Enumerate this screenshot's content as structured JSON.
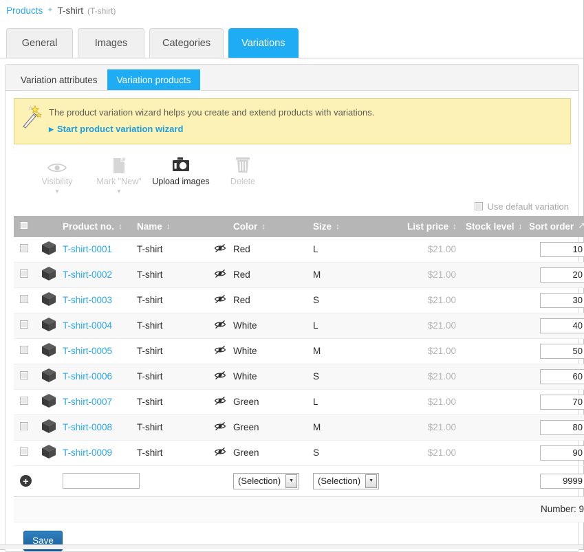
{
  "breadcrumb": {
    "root": "Products",
    "separator": "✦",
    "current": "T-shirt",
    "current_sub": "(T-shirt)"
  },
  "tabs": [
    {
      "label": "General",
      "active": false
    },
    {
      "label": "Images",
      "active": false
    },
    {
      "label": "Categories",
      "active": false
    },
    {
      "label": "Variations",
      "active": true
    }
  ],
  "subtabs": [
    {
      "label": "Variation attributes",
      "active": false
    },
    {
      "label": "Variation products",
      "active": true
    }
  ],
  "wizard": {
    "icon": "magic-wand-icon",
    "text": "The product variation wizard helps you create and extend products with variations.",
    "link": "Start product variation wizard"
  },
  "toolbar": [
    {
      "label": "Visibility",
      "icon": "eye-icon",
      "enabled": false,
      "caret": true
    },
    {
      "label": "Mark \"New\"",
      "icon": "page-star-icon",
      "enabled": false,
      "caret": true
    },
    {
      "label": "Upload images",
      "icon": "camera-icon",
      "enabled": true,
      "caret": false
    },
    {
      "label": "Delete",
      "icon": "trash-icon",
      "enabled": false,
      "caret": false
    }
  ],
  "default_variation": {
    "label": "Use default variation",
    "checked": false
  },
  "table": {
    "columns": [
      {
        "label": "Product no.",
        "sort": "updown"
      },
      {
        "label": "Name",
        "sort": "updown"
      },
      {
        "label": "Color",
        "sort": "updown"
      },
      {
        "label": "Size",
        "sort": "updown"
      },
      {
        "label": "List price",
        "sort": "updown"
      },
      {
        "label": "Stock level",
        "sort": "updown"
      },
      {
        "label": "Sort order",
        "sort": "custom"
      }
    ],
    "rows": [
      {
        "product_no": "T-shirt-0001",
        "name": "T-shirt",
        "color": "Red",
        "size": "L",
        "list_price": "$21.00",
        "stock_level": "",
        "sort_order": "10"
      },
      {
        "product_no": "T-shirt-0002",
        "name": "T-shirt",
        "color": "Red",
        "size": "M",
        "list_price": "$21.00",
        "stock_level": "",
        "sort_order": "20"
      },
      {
        "product_no": "T-shirt-0003",
        "name": "T-shirt",
        "color": "Red",
        "size": "S",
        "list_price": "$21.00",
        "stock_level": "",
        "sort_order": "30"
      },
      {
        "product_no": "T-shirt-0004",
        "name": "T-shirt",
        "color": "White",
        "size": "L",
        "list_price": "$21.00",
        "stock_level": "",
        "sort_order": "40"
      },
      {
        "product_no": "T-shirt-0005",
        "name": "T-shirt",
        "color": "White",
        "size": "M",
        "list_price": "$21.00",
        "stock_level": "",
        "sort_order": "50"
      },
      {
        "product_no": "T-shirt-0006",
        "name": "T-shirt",
        "color": "White",
        "size": "S",
        "list_price": "$21.00",
        "stock_level": "",
        "sort_order": "60"
      },
      {
        "product_no": "T-shirt-0007",
        "name": "T-shirt",
        "color": "Green",
        "size": "L",
        "list_price": "$21.00",
        "stock_level": "",
        "sort_order": "70"
      },
      {
        "product_no": "T-shirt-0008",
        "name": "T-shirt",
        "color": "Green",
        "size": "M",
        "list_price": "$21.00",
        "stock_level": "",
        "sort_order": "80"
      },
      {
        "product_no": "T-shirt-0009",
        "name": "T-shirt",
        "color": "Green",
        "size": "S",
        "list_price": "$21.00",
        "stock_level": "",
        "sort_order": "90"
      }
    ],
    "new_row": {
      "add_icon": "plus-circle-icon",
      "product_no_value": "",
      "color_select": "(Selection)",
      "size_select": "(Selection)",
      "sort_order": "9999"
    },
    "footer": "Number: 9"
  },
  "save": {
    "label": "Save"
  },
  "colors": {
    "accent_blue": "#1eacf5",
    "link_blue": "#2aa6ea",
    "header_gray": "#b6b6b6",
    "notice_yellow": "#fdf2b6",
    "save_blue": "#195a94"
  }
}
